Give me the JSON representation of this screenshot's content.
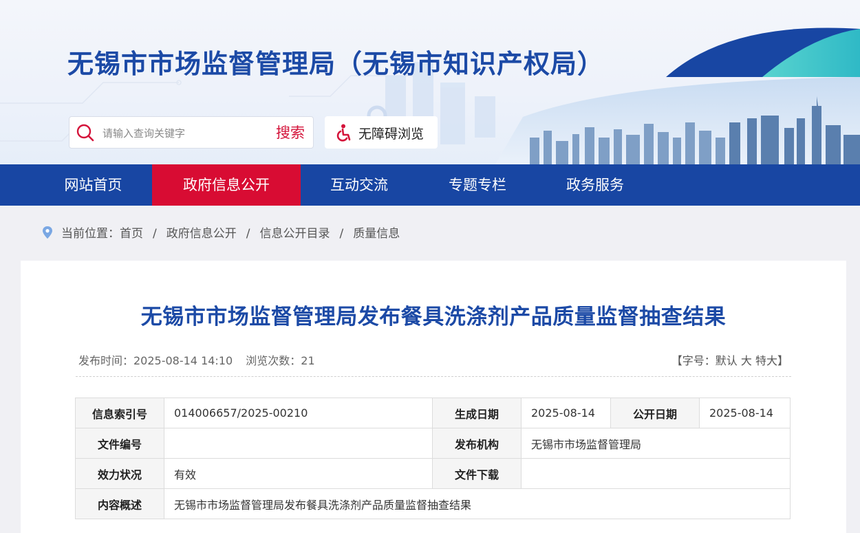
{
  "header": {
    "site_title": "无锡市市场监督管理局（无锡市知识产权局）",
    "search": {
      "placeholder": "请输入查询关键字",
      "button_label": "搜索"
    },
    "accessibility_label": "无障碍浏览"
  },
  "nav": {
    "items": [
      {
        "label": "网站首页",
        "active": false
      },
      {
        "label": "政府信息公开",
        "active": true
      },
      {
        "label": "互动交流",
        "active": false
      },
      {
        "label": "专题专栏",
        "active": false
      },
      {
        "label": "政务服务",
        "active": false
      }
    ]
  },
  "breadcrumb": {
    "prefix": "当前位置：",
    "items": [
      "首页",
      "政府信息公开",
      "信息公开目录",
      "质量信息"
    ],
    "separator": "/"
  },
  "article": {
    "title": "无锡市市场监督管理局发布餐具洗涤剂产品质量监督抽查结果",
    "publish_time": "发布时间：2025-08-14 14:10",
    "views": "浏览次数：21",
    "font_size": {
      "open": "【",
      "label": "字号：",
      "default": "默认",
      "large": "大",
      "xlarge": "特大",
      "close": "】"
    }
  },
  "info_table": {
    "index_label": "信息索引号",
    "index_value": "014006657/2025-00210",
    "gen_date_label": "生成日期",
    "gen_date_value": "2025-08-14",
    "pub_date_label": "公开日期",
    "pub_date_value": "2025-08-14",
    "doc_no_label": "文件编号",
    "doc_no_value": "",
    "issuer_label": "发布机构",
    "issuer_value": "无锡市市场监督管理局",
    "validity_label": "效力状况",
    "validity_value": "有效",
    "download_label": "文件下载",
    "download_value": "",
    "summary_label": "内容概述",
    "summary_value": "无锡市市场监督管理局发布餐具洗涤剂产品质量监督抽查结果"
  },
  "colors": {
    "brand_blue": "#1846a3",
    "title_blue": "#1c4aa6",
    "active_red": "#d80c33",
    "teal": "#3ec8c8"
  }
}
